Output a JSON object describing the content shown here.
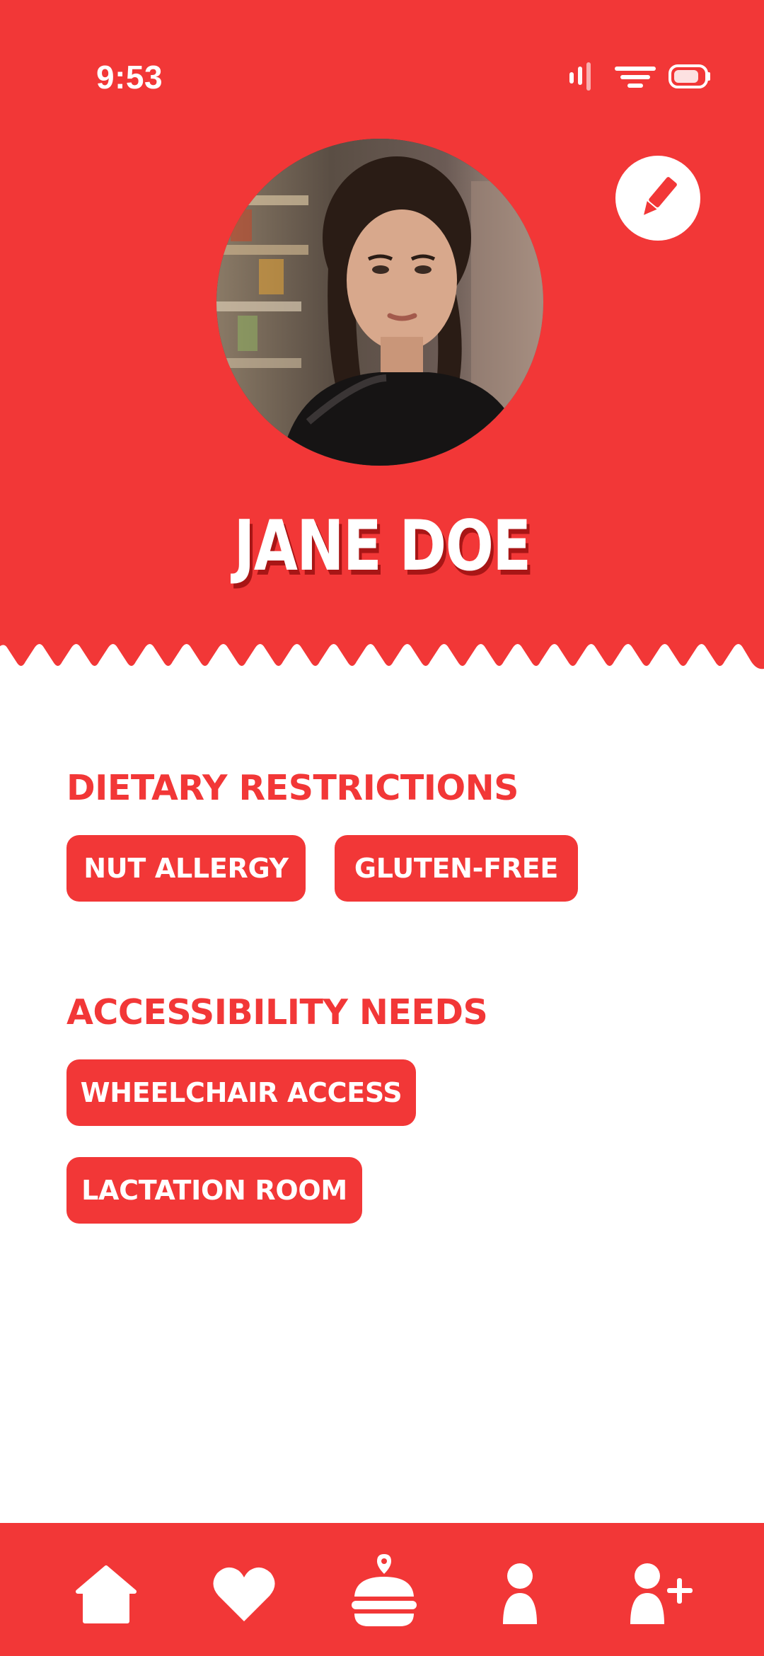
{
  "status_bar": {
    "time": "9:53",
    "icons": [
      "signal-icon",
      "wifi-icon",
      "battery-icon"
    ]
  },
  "profile": {
    "name": "JANE DOE",
    "avatar": "profile-photo",
    "edit_icon": "pencil-icon"
  },
  "sections": [
    {
      "title": "DIETARY RESTRICTIONS",
      "tags": [
        "NUT ALLERGY",
        "GLUTEN-FREE"
      ]
    },
    {
      "title": "ACCESSIBILITY NEEDS",
      "tags": [
        "WHEELCHAIR ACCESS",
        "LACTATION ROOM"
      ]
    }
  ],
  "bottom_nav": {
    "items": [
      "home-icon",
      "heart-icon",
      "burger-location-icon",
      "person-icon",
      "add-person-icon"
    ]
  },
  "colors": {
    "brand_red": "#F23737",
    "background": "#FFFFFF",
    "text_on_brand": "#FFFFFF"
  }
}
